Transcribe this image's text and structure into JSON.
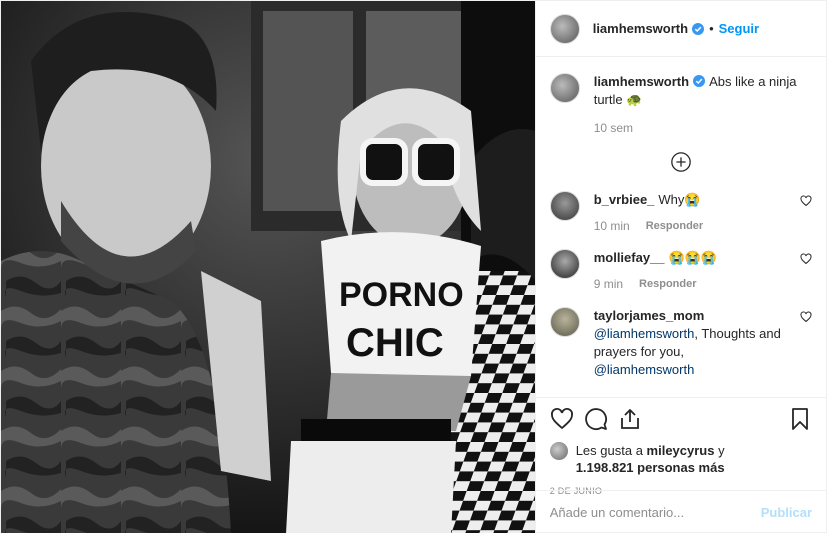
{
  "header": {
    "username": "liamhemsworth",
    "separator": "•",
    "follow_label": "Seguir"
  },
  "caption": {
    "username": "liamhemsworth",
    "text": "Abs like a ninja turtle 🐢",
    "time": "10 sem"
  },
  "comments": [
    {
      "username": "b_vrbiee_",
      "text": "Why😭",
      "time": "10 min",
      "reply_label": "Responder"
    },
    {
      "username": "molliefay__",
      "text": "😭😭😭",
      "time": "9 min",
      "reply_label": "Responder"
    },
    {
      "username": "taylorjames_mom",
      "mention1": "@liamhemsworth",
      "text": ", Thoughts and prayers for you, ",
      "mention2": "@liamhemsworth"
    }
  ],
  "likes": {
    "prefix": "Les gusta a ",
    "user": "mileycyrus",
    "conj": " y",
    "count": "1.198.821 personas más"
  },
  "date": "2 DE JUNIO",
  "comment_box": {
    "placeholder": "Añade un comentario...",
    "publish_label": "Publicar"
  },
  "icons": {
    "verified": "verified-badge-icon",
    "load_more": "plus-circle-icon",
    "like": "heart-icon",
    "comment": "comment-bubble-icon",
    "share": "share-upload-icon",
    "save": "bookmark-icon"
  },
  "colors": {
    "link_blue": "#0095f6",
    "publish_disabled": "#b2dffc",
    "muted": "#8e8e8e",
    "text": "#262626",
    "mention": "#00376b"
  }
}
